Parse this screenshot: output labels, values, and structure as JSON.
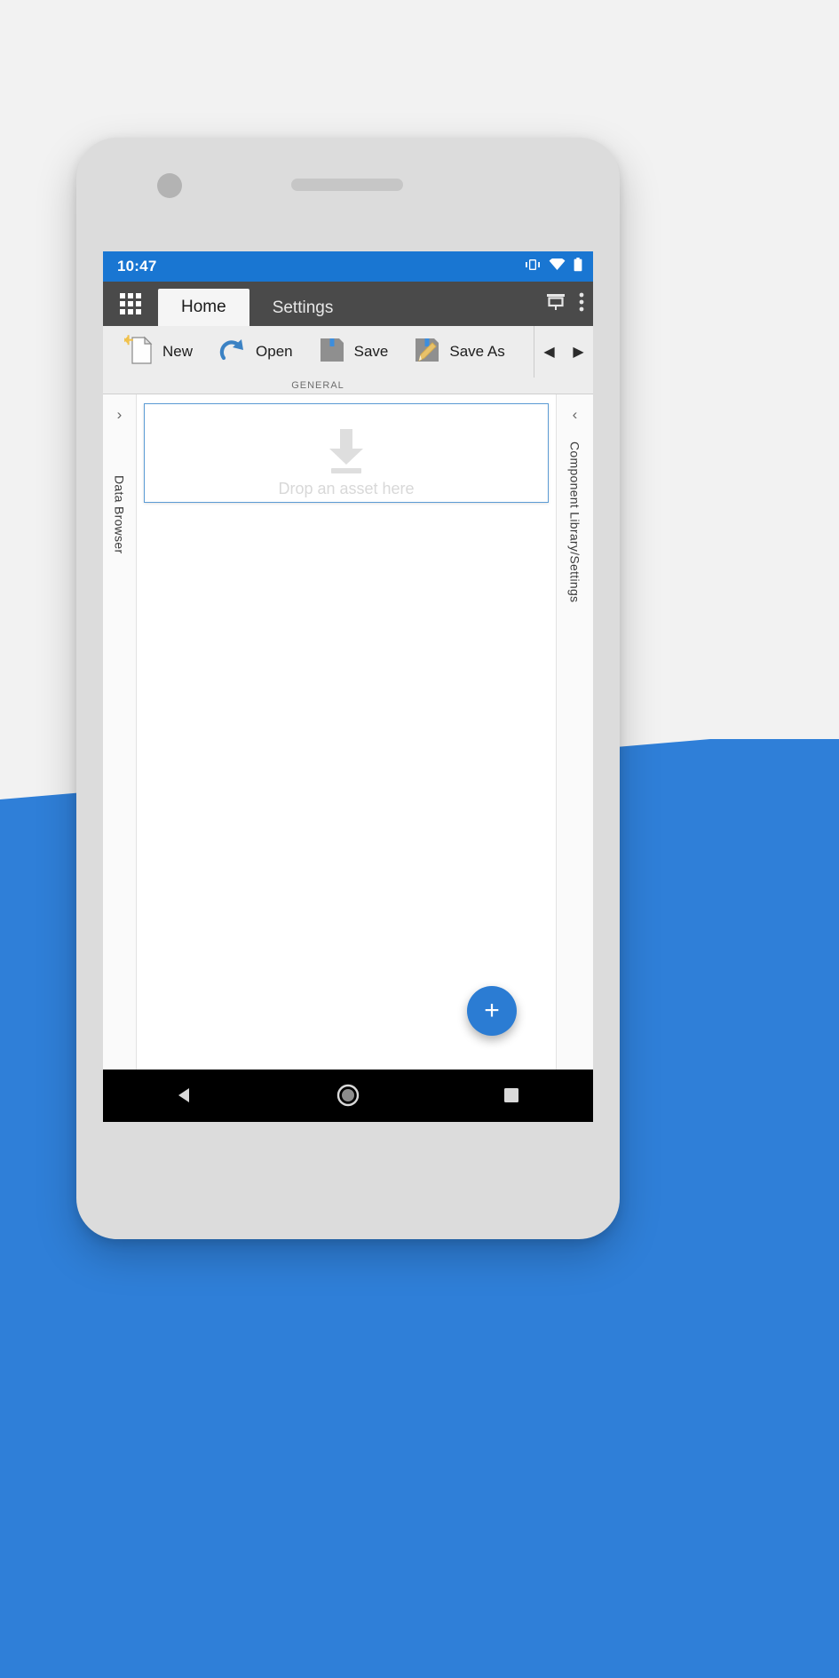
{
  "statusbar": {
    "time": "10:47",
    "icons": [
      "vibrate-icon",
      "wifi-icon",
      "battery-icon"
    ]
  },
  "tabbar": {
    "app_grid_icon": "app-grid-icon",
    "tabs": [
      {
        "label": "Home",
        "active": true
      },
      {
        "label": "Settings",
        "active": false
      }
    ],
    "right_icons": [
      "presentation-icon",
      "overflow-menu-icon"
    ]
  },
  "ribbon": {
    "caption": "GENERAL",
    "items": [
      {
        "label": "New",
        "icon": "new-document-icon"
      },
      {
        "label": "Open",
        "icon": "open-folder-arrow-icon"
      },
      {
        "label": "Save",
        "icon": "save-floppy-icon"
      },
      {
        "label": "Save As",
        "icon": "save-as-floppy-pencil-icon"
      }
    ],
    "nav_prev": "◀",
    "nav_next": "▶"
  },
  "left_panel": {
    "label": "Data Browser",
    "expand_icon": "chevron-right-icon"
  },
  "right_panel": {
    "label": "Component Library/Settings",
    "collapse_icon": "chevron-left-icon"
  },
  "canvas": {
    "dropzone_text": "Drop an asset here",
    "dropzone_icon": "download-arrow-icon",
    "border_color": "#5b9bd5"
  },
  "fab": {
    "label": "+",
    "color": "#2b7cd3",
    "icon": "plus-icon"
  },
  "navbar": {
    "back": "back-triangle-icon",
    "home": "home-circle-icon",
    "recents": "recents-square-icon"
  },
  "theme": {
    "status_blue": "#1976d2",
    "tabbar_dark": "#4a4a4a",
    "ribbon_grey": "#ededed",
    "background_blue": "#2f7fd8",
    "background_light": "#f2f2f2"
  }
}
